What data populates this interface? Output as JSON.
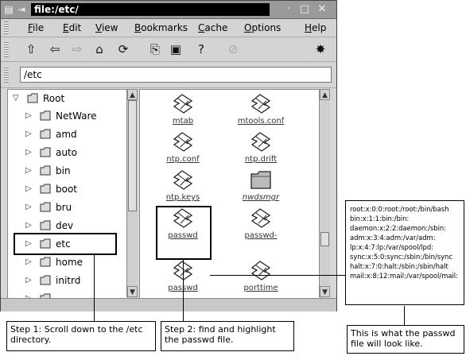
{
  "window": {
    "title": "file:/etc/",
    "menu": [
      "File",
      "Edit",
      "View",
      "Bookmarks",
      "Cache",
      "Options",
      "Help"
    ],
    "location": "/etc",
    "controls": [
      "minimize",
      "maximize",
      "close"
    ]
  },
  "tree": {
    "root_label": "Root",
    "items": [
      {
        "label": "NetWare"
      },
      {
        "label": "amd"
      },
      {
        "label": "auto"
      },
      {
        "label": "bin"
      },
      {
        "label": "boot"
      },
      {
        "label": "bru"
      },
      {
        "label": "dev"
      },
      {
        "label": "etc"
      },
      {
        "label": "home"
      },
      {
        "label": "initrd"
      }
    ]
  },
  "files": [
    {
      "name": "mtab",
      "type": "document"
    },
    {
      "name": "mtools.conf",
      "type": "document"
    },
    {
      "name": "ntp.conf",
      "type": "document"
    },
    {
      "name": "ntp.drift",
      "type": "document"
    },
    {
      "name": "ntp.keys",
      "type": "document"
    },
    {
      "name": "nwdsmgr",
      "type": "folder"
    },
    {
      "name": "passwd",
      "type": "document"
    },
    {
      "name": "passwd-",
      "type": "document"
    },
    {
      "name": "passwd",
      "type": "document"
    },
    {
      "name": "porttime",
      "type": "document"
    }
  ],
  "passwd_preview": [
    "root:x:0:0:root:/root:/bin/bash",
    "bin:x:1:1:bin:/bin:",
    "daemon:x:2:2:daemon:/sbin:",
    "adm:x:3:4:adm:/var/adm:",
    "lp:x:4:7:lp:/var/spool/lpd:",
    "sync:x:5:0:sync:/sbin:/bin/sync",
    "halt:x:7:0:halt:/sbin:/sbin/halt",
    "mail:x:8:12:mail:/var/spool/mail:"
  ],
  "callouts": {
    "step1": "Step 1: Scroll down to the /etc directory.",
    "step2": "Step 2: find and highlight the passwd file.",
    "step3": "This is what the passwd file will look like."
  }
}
